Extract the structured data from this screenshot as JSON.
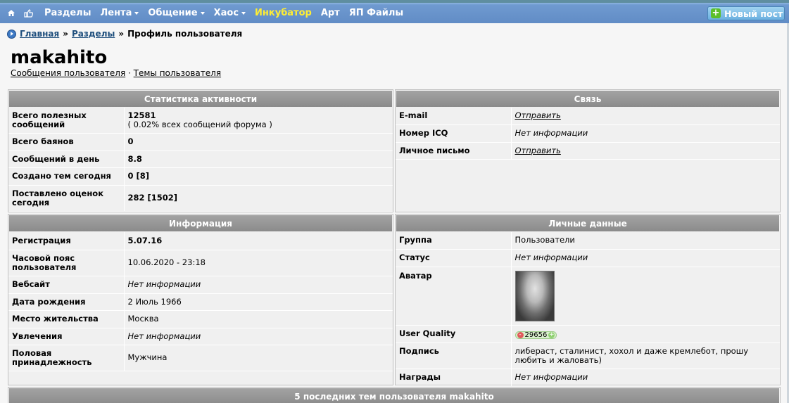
{
  "nav": {
    "items": [
      {
        "label": "Разделы",
        "dropdown": false,
        "highlight": false
      },
      {
        "label": "Лента",
        "dropdown": true,
        "highlight": false
      },
      {
        "label": "Общение",
        "dropdown": true,
        "highlight": false
      },
      {
        "label": "Хаос",
        "dropdown": true,
        "highlight": false
      },
      {
        "label": "Инкубатор",
        "dropdown": false,
        "highlight": true
      },
      {
        "label": "Арт",
        "dropdown": false,
        "highlight": false
      },
      {
        "label": "ЯП Файлы",
        "dropdown": false,
        "highlight": false
      }
    ],
    "new_post": "Новый пост",
    "icons": [
      "home-icon",
      "thumbs-up-icon"
    ]
  },
  "breadcrumb": {
    "home": "Главная",
    "sections": "Разделы",
    "current": "Профиль пользователя",
    "sep": "»"
  },
  "profile": {
    "username": "makahito",
    "links": {
      "messages": "Сообщения пользователя",
      "sep": "·",
      "topics": "Темы пользователя"
    }
  },
  "stats": {
    "title": "Статистика активности",
    "rows": [
      {
        "label": "Всего полезных сообщений",
        "value": "12581",
        "note": "( 0.02% всех сообщений форума )"
      },
      {
        "label": "Всего баянов",
        "value": "0"
      },
      {
        "label": "Сообщений в день",
        "value": "8.8"
      },
      {
        "label": "Создано тем сегодня",
        "value": "0 [8]"
      },
      {
        "label": "Поставлено оценок сегодня",
        "value": "282 [1502]"
      }
    ]
  },
  "contact": {
    "title": "Связь",
    "rows": [
      {
        "label": "E-mail",
        "value": "Отправить"
      },
      {
        "label": "Номер ICQ",
        "value": "Нет информации"
      },
      {
        "label": "Личное письмо",
        "value": "Отправить"
      }
    ]
  },
  "info": {
    "title": "Информация",
    "rows": [
      {
        "label": "Регистрация",
        "value": "5.07.16"
      },
      {
        "label": "Часовой пояс пользователя",
        "value": "10.06.2020 - 23:18"
      },
      {
        "label": "Вебсайт",
        "value": "Нет информации"
      },
      {
        "label": "Дата рождения",
        "value": "2 Июль 1966"
      },
      {
        "label": "Место жительства",
        "value": "Москва"
      },
      {
        "label": "Увлечения",
        "value": "Нет информации"
      },
      {
        "label": "Половая принадлежность",
        "value": "Мужчина"
      }
    ]
  },
  "personal": {
    "title": "Личные данные",
    "rows": {
      "group": {
        "label": "Группа",
        "value": "Пользователи"
      },
      "status": {
        "label": "Статус",
        "value": "Нет информации"
      },
      "avatar": {
        "label": "Аватар"
      },
      "quality": {
        "label": "User Quality",
        "value": "29656",
        "minus": "-",
        "plus": "+"
      },
      "signature": {
        "label": "Подпись",
        "value": "либераст, сталинист, хохол и даже кремлебот, прошу любить и жаловать)"
      },
      "awards": {
        "label": "Награды",
        "value": "Нет информации"
      }
    }
  },
  "recent": {
    "title": "5 последних тем пользователя makahito"
  }
}
